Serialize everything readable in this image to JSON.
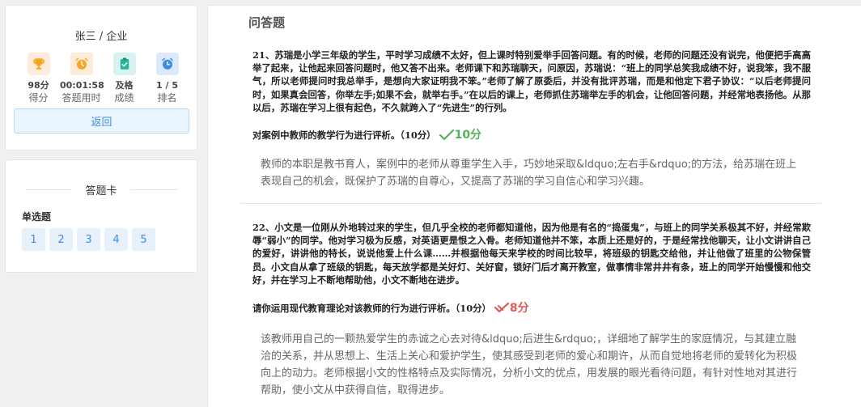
{
  "profile": {
    "name": "张三 / 企业",
    "stats": [
      {
        "value": "98分",
        "label": "得分",
        "icon": "trophy-icon"
      },
      {
        "value": "00:01:58",
        "label": "答题用时",
        "icon": "alarm-clock-icon"
      },
      {
        "value": "及格",
        "label": "成绩",
        "icon": "clipboard-check-icon"
      },
      {
        "value": "1 / 5",
        "label": "排名",
        "icon": "clock-icon"
      }
    ],
    "back_label": "返回"
  },
  "answer_card": {
    "title": "答题卡",
    "section": "单选题",
    "numbers": [
      "1",
      "2",
      "3",
      "4",
      "5"
    ]
  },
  "main": {
    "title": "问答题",
    "questions": [
      {
        "text": "21、苏瑞是小学三年级的学生，平时学习成绩不太好，但上课时特别爱举手回答问题。有的时候，老师的问题还没有说完，他便把手高高举了起来，让他起来回答问题时，他又答不出来。老师课下和苏瑞聊天，问原因，苏瑞说：“班上的同学总笑我成绩不好，说我笨，我不服气，所以老师提问时我总举手，是想向大家证明我不笨。”老师了解了原委后，并没有批评苏瑞，而是和他定下君子协议：“以后老师提问时，如果真会回答，你举左手;如果不会，就举右手。”在以后的课上，老师抓住苏瑞举左手的机会，让他回答问题，并经常地表扬他。从那以后，苏瑞在学习上很有起色，不久就跨入了“先进生”的行列。",
        "prompt": "对案例中教师的教学行为进行评析。（10分）",
        "score": "10分",
        "answer": "教师的本职是教书育人，案例中的老师从尊重学生入手，巧妙地采取&ldquo;左右手&rdquo;的方法，给苏瑞在班上表现自己的机会，既保护了苏瑞的自尊心，又提高了苏瑞的学习自信心和学习兴趣。"
      },
      {
        "text": "22、小文是一位刚从外地转过来的学生，但几乎全校的老师都知道他，因为他是有名的“捣蛋鬼”，与班上的同学关系极其不好，并经常欺辱“弱小”的同学。他对学习极为反感，对英语更是恨之入骨。老师知道他并不笨，本质上还是好的，于是经常找他聊天，让小文讲讲自己的爱好，讲讲他的特长，说说他爱上什么课……并根据他每天来学校的时间比较早，将班级的钥匙交给他，并让他做了班里的公物保管员。小文自从拿了班级的钥匙，每天放学都是关好灯、关好窗，锁好门后才离开教室，做事情非常井井有条，班上的同学开始慢慢和他交好，并在学习上不断地帮助他，小文不断地在进步。",
        "prompt": "请你运用现代教育理论对该教师的行为进行评析。（10分）",
        "score": "8分",
        "answer": "该教师用自己的一颗热爱学生的赤诚之心去对待&ldquo;后进生&rdquo;，详细地了解学生的家庭情况，与其建立融洽的关系，并从思想上、生活上关心和爱护学生，使其感受到老师的爱心和期许，从而自觉地将老师的爱转化为积极向上的动力。老师根据小文的性格特点及实际情况，分析小文的优点，用发展的眼光看待问题，有针对性地对其进行帮助，使小文从中获得自信，取得进步。"
      }
    ]
  },
  "colors": {
    "accent": "#3d8ee0",
    "good": "#52b35c",
    "bad": "#e05a5a",
    "orange": "#f5a623",
    "teal": "#2bb5a0",
    "blue": "#3d8ee0"
  }
}
